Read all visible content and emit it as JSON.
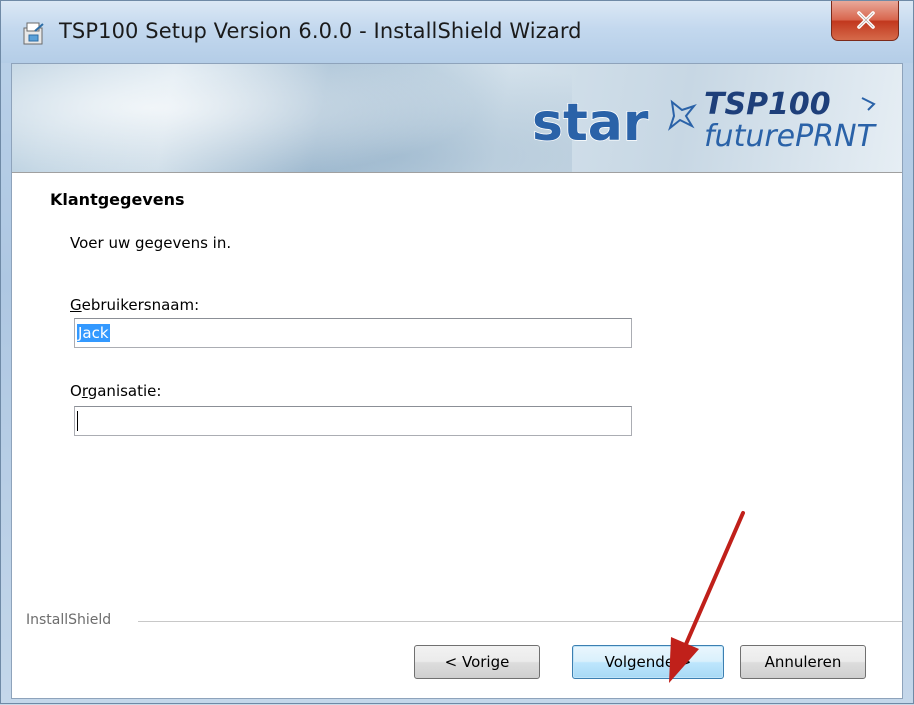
{
  "window": {
    "title": "TSP100 Setup Version 6.0.0 - InstallShield Wizard"
  },
  "banner": {
    "brand": "star",
    "product": "TSP100",
    "product_line": "futurePRNT"
  },
  "page": {
    "heading": "Klantgegevens",
    "subtext": "Voer uw gegevens in."
  },
  "form": {
    "username_label_first": "G",
    "username_label_rest": "ebruikersnaam:",
    "username_value": "Jack",
    "org_label_first": "O",
    "org_label_mid": "r",
    "org_label_rest": "ganisatie:",
    "org_value": ""
  },
  "footer": {
    "brand": "InstallShield"
  },
  "buttons": {
    "back": "< Vorige",
    "next": "Volgende >",
    "cancel": "Annuleren"
  },
  "colors": {
    "accent_selection": "#3399ff",
    "annotation_arrow": "#c0201a",
    "logo_blue": "#2a62a8"
  }
}
